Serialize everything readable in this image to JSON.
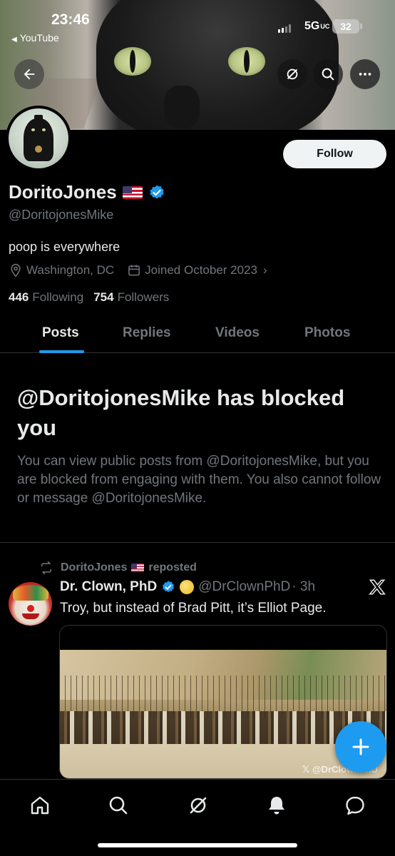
{
  "status_bar": {
    "time": "23:46",
    "back_app": "YouTube",
    "network": "5G",
    "network_suffix": "UC",
    "battery": "32"
  },
  "header_buttons": {
    "back": "back-arrow-icon",
    "grok": "grok-icon",
    "search": "search-icon",
    "more": "more-icon"
  },
  "profile": {
    "display_name": "DoritoJones",
    "handle": "@DoritojonesMike",
    "bio": "poop is everywhere",
    "location": "Washington, DC",
    "joined": "Joined October 2023",
    "following_count": "446",
    "following_label": "Following",
    "followers_count": "754",
    "followers_label": "Followers",
    "follow_button": "Follow"
  },
  "tabs": [
    "Posts",
    "Replies",
    "Videos",
    "Photos"
  ],
  "active_tab": "Posts",
  "blocked": {
    "title": "@DoritojonesMike has blocked you",
    "message": "You can view public posts from @DoritojonesMike, but you are blocked from engaging with them. You also cannot follow or message @DoritojonesMike."
  },
  "post": {
    "repost_name": "DoritoJones",
    "repost_label": "reposted",
    "author_name": "Dr. Clown, PhD",
    "author_handle": "@DrClownPhD",
    "time": "· 3h",
    "text": "Troy, but instead of Brad Pitt, it’s Elliot Page.",
    "media_watermark": "@DrClownPhD"
  },
  "bottom_nav": [
    "home-icon",
    "search-icon",
    "grok-icon",
    "notifications-icon",
    "messages-icon"
  ],
  "colors": {
    "accent": "#1d9bf0",
    "background": "#000000",
    "text_primary": "#e7e9ea",
    "text_secondary": "#71767b"
  }
}
